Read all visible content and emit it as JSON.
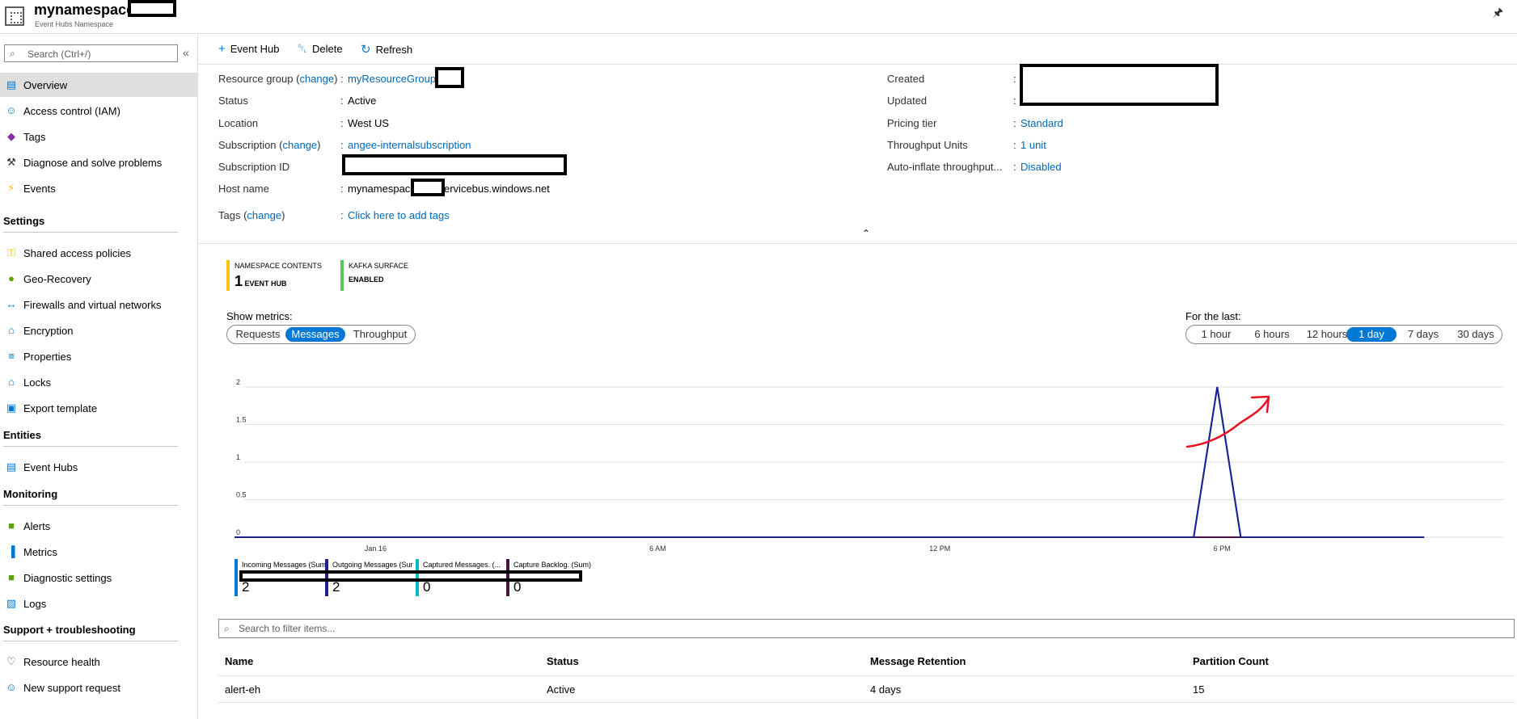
{
  "header": {
    "title": "mynamespace",
    "subtitle": "Event Hubs Namespace"
  },
  "sidebar": {
    "search_placeholder": "Search (Ctrl+/)",
    "items_top": [
      {
        "label": "Overview",
        "icon": "overview-icon"
      },
      {
        "label": "Access control (IAM)",
        "icon": "iam-icon"
      },
      {
        "label": "Tags",
        "icon": "tag-icon"
      },
      {
        "label": "Diagnose and solve problems",
        "icon": "wrench-icon"
      },
      {
        "label": "Events",
        "icon": "lightning-icon"
      }
    ],
    "sections": {
      "settings": "Settings",
      "entities": "Entities",
      "monitoring": "Monitoring",
      "support": "Support + troubleshooting"
    },
    "settings_items": [
      {
        "label": "Shared access policies",
        "icon": "key-icon"
      },
      {
        "label": "Geo-Recovery",
        "icon": "globe-icon"
      },
      {
        "label": "Firewalls and virtual networks",
        "icon": "network-icon"
      },
      {
        "label": "Encryption",
        "icon": "lock-icon"
      },
      {
        "label": "Properties",
        "icon": "properties-icon"
      },
      {
        "label": "Locks",
        "icon": "lock-icon"
      },
      {
        "label": "Export template",
        "icon": "export-icon"
      }
    ],
    "entities_items": [
      {
        "label": "Event Hubs",
        "icon": "event-hubs-icon"
      }
    ],
    "monitoring_items": [
      {
        "label": "Alerts",
        "icon": "alert-icon"
      },
      {
        "label": "Metrics",
        "icon": "metrics-icon"
      },
      {
        "label": "Diagnostic settings",
        "icon": "diagnostic-icon"
      },
      {
        "label": "Logs",
        "icon": "logs-icon"
      }
    ],
    "support_items": [
      {
        "label": "Resource health",
        "icon": "heart-icon"
      },
      {
        "label": "New support request",
        "icon": "support-icon"
      }
    ]
  },
  "toolbar": {
    "event_hub": "Event Hub",
    "delete": "Delete",
    "refresh": "Refresh"
  },
  "essentials": {
    "resource_group_label": "Resource group",
    "change": "change",
    "resource_group_value": "myResourceGroup",
    "status_label": "Status",
    "status_value": "Active",
    "location_label": "Location",
    "location_value": "West US",
    "subscription_label": "Subscription",
    "subscription_value": "angee-internalsubscription",
    "subscription_id_label": "Subscription ID",
    "host_name_label": "Host name",
    "host_name_prefix": "mynamespace",
    "host_name_suffix": "ervicebus.windows.net",
    "tags_label": "Tags",
    "tags_value": "Click here to add tags",
    "created_label": "Created",
    "updated_label": "Updated",
    "pricing_tier_label": "Pricing tier",
    "pricing_tier_value": "Standard",
    "throughput_units_label": "Throughput Units",
    "throughput_units_value": "1 unit",
    "auto_inflate_label": "Auto-inflate throughput...",
    "auto_inflate_value": "Disabled",
    "colon": ":"
  },
  "tiles": [
    {
      "title": "Namespace contents",
      "number": "1",
      "unit": "EVENT HUB",
      "color": "#ffc20e"
    },
    {
      "title": "Kafka surface",
      "number": "",
      "unit": "ENABLED",
      "color": "#5bc45b"
    }
  ],
  "metrics": {
    "show_label": "Show metrics:",
    "metric_options": [
      "Requests",
      "Messages",
      "Throughput"
    ],
    "metric_selected": "Messages",
    "time_label": "For the last:",
    "time_options": [
      "1 hour",
      "6 hours",
      "12 hours",
      "1 day",
      "7 days",
      "30 days"
    ],
    "time_selected": "1 day"
  },
  "chart_data": {
    "type": "line",
    "x_ticks": [
      "Jan 16",
      "6 AM",
      "12 PM",
      "6 PM"
    ],
    "y_ticks": [
      "0",
      "0.5",
      "1",
      "1.5",
      "2"
    ],
    "ylim": [
      0,
      2
    ],
    "x_hours": [
      -3,
      0,
      6,
      12,
      18,
      24
    ],
    "series": [
      {
        "name": "Incoming Messages (Sum)",
        "color": "#0078d4",
        "points": [
          [
            -3,
            0
          ],
          [
            17.4,
            0
          ],
          [
            17.9,
            2
          ],
          [
            18.4,
            0
          ],
          [
            22.3,
            0
          ]
        ]
      },
      {
        "name": "Outgoing Messages (Sum)",
        "color": "#1f1f8e",
        "points": [
          [
            -3,
            0
          ],
          [
            17.4,
            0
          ],
          [
            17.9,
            2
          ],
          [
            18.4,
            0
          ],
          [
            22.3,
            0
          ]
        ]
      },
      {
        "name": "Captured Messages. (Sum)",
        "color": "#00b7c3",
        "points": [
          [
            -3,
            0
          ],
          [
            22.3,
            0
          ]
        ]
      },
      {
        "name": "Capture Backlog. (Sum)",
        "color": "#4b1042",
        "points": [
          [
            -3,
            0
          ],
          [
            22.3,
            0
          ]
        ]
      }
    ],
    "legend_labels": [
      "Incoming Messages (Sum",
      "Outgoing Messages (Sur",
      "Captured Messages. (...",
      "Capture Backlog. (Sum)"
    ],
    "legend_values": [
      "2",
      "2",
      "0",
      "0"
    ],
    "legend_colors": [
      "#0078d4",
      "#1f1f8e",
      "#00b7c3",
      "#4b1042"
    ],
    "grid": true
  },
  "table": {
    "filter_placeholder": "Search to filter items...",
    "columns": [
      "Name",
      "Status",
      "Message Retention",
      "Partition Count"
    ],
    "rows": [
      {
        "name": "alert-eh",
        "status": "Active",
        "retention": "4 days",
        "partitions": "15"
      }
    ]
  }
}
